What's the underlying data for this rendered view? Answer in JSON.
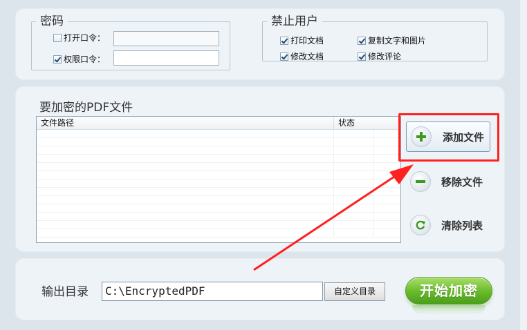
{
  "password_group": {
    "legend": "密码",
    "open_password": {
      "label": "打开口令：",
      "checked": false,
      "value": ""
    },
    "permission_password": {
      "label": "权限口令：",
      "checked": true,
      "value": ""
    }
  },
  "restrict_group": {
    "legend": "禁止用户",
    "options": [
      {
        "label": "打印文档",
        "checked": true
      },
      {
        "label": "复制文字和图片",
        "checked": true
      },
      {
        "label": "修改文档",
        "checked": true
      },
      {
        "label": "修改评论",
        "checked": true
      }
    ]
  },
  "file_section": {
    "title": "要加密的PDF文件",
    "columns": [
      "文件路径",
      "状态"
    ]
  },
  "actions": {
    "add": "添加文件",
    "remove": "移除文件",
    "clear": "清除列表"
  },
  "output": {
    "label": "输出目录",
    "path": "C:\\EncryptedPDF",
    "custom_button": "自定义目录",
    "start_button": "开始加密"
  },
  "colors": {
    "highlight": "#ff2020",
    "start_button": "#6cbd2d",
    "plus_icon": "#3a9a1e",
    "minus_icon": "#3a9a1e"
  },
  "icons": {
    "add": "plus-icon",
    "remove": "minus-icon",
    "clear": "refresh-icon"
  }
}
